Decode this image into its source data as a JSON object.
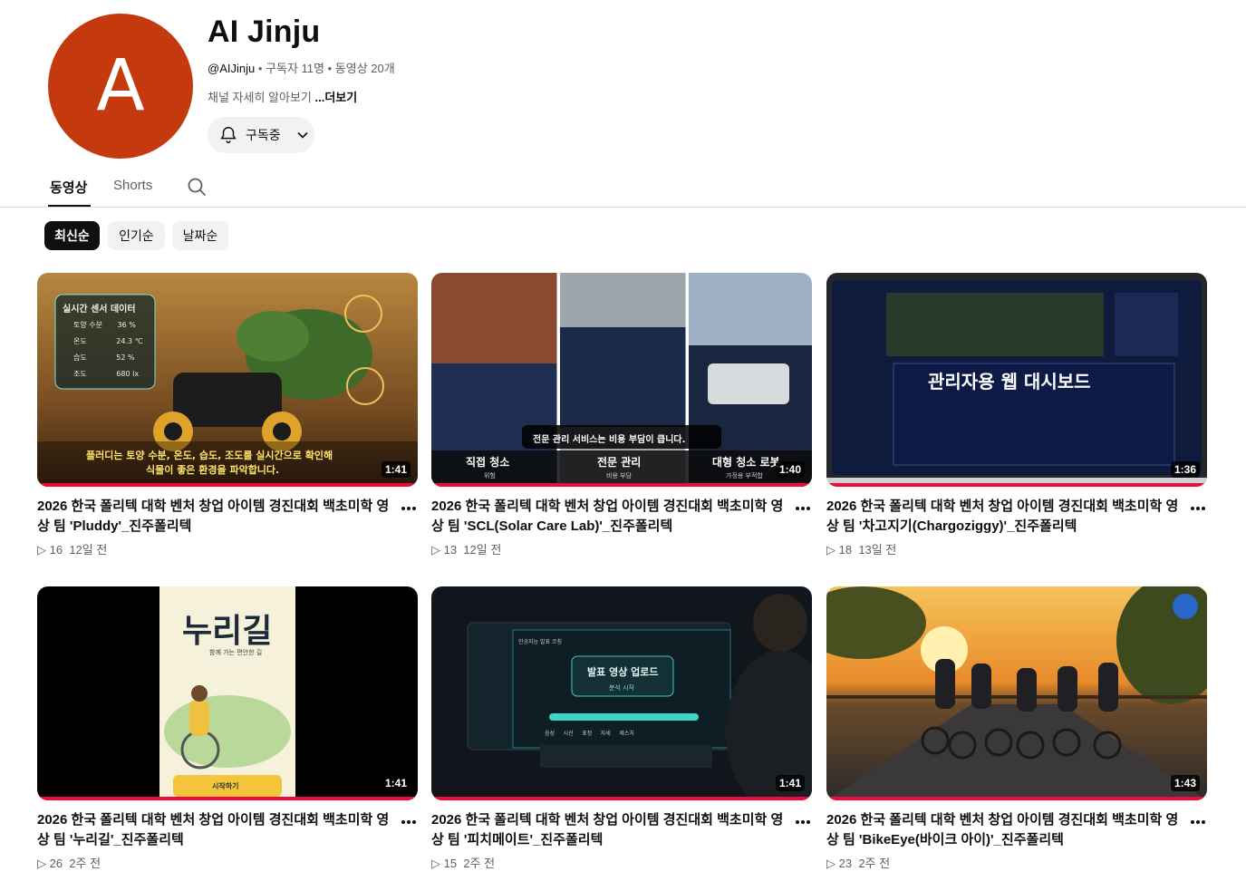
{
  "channel": {
    "avatar_letter": "A",
    "avatar_color": "#c5390f",
    "name": "AI Jinju",
    "handle": "@AIJinju",
    "subscribers": "구독자 11명",
    "video_count": "동영상 20개",
    "separator": "•",
    "description": "채널 자세히 알아보기",
    "more_label": "...더보기",
    "subscribe_label": "구독중",
    "bell_icon": "bell-icon",
    "dropdown_icon": "chevron-down-icon"
  },
  "tabs": [
    {
      "label": "동영상",
      "active": true
    },
    {
      "label": "Shorts",
      "active": false
    }
  ],
  "search_icon": "search-icon",
  "chips": [
    {
      "label": "최신순",
      "active": true
    },
    {
      "label": "인기순",
      "active": false
    },
    {
      "label": "날짜순",
      "active": false
    }
  ],
  "accent_color": "#f00a3a",
  "videos": [
    {
      "title": "2026 한국 폴리텍 대학 벤처 창업 아이템 경진대회 백초미학 영상 팀 'Pluddy'_진주폴리텍",
      "duration": "1:41",
      "views": "16",
      "age": "12일 전",
      "thumb_text": {
        "panel_title": "실시간 센서 데이터",
        "rows": [
          {
            "label": "토양 수분",
            "value": "36 %"
          },
          {
            "label": "온도",
            "value": "24.3 ℃"
          },
          {
            "label": "습도",
            "value": "52 %"
          },
          {
            "label": "조도",
            "value": "680 lx"
          }
        ],
        "caption1": "플러디는 토양 수분, 온도, 습도, 조도를 실시간으로 확인해",
        "caption2": "식물이 좋은 환경을 파악합니다."
      }
    },
    {
      "title": "2026 한국 폴리텍 대학 벤처 창업 아이템 경진대회 백초미학 영상 팀 'SCL(Solar Care Lab)'_진주폴리텍",
      "duration": "1:40",
      "views": "13",
      "age": "12일 전",
      "thumb_text": {
        "banner": "전문 관리 서비스는 비용 부담이 큽니다.",
        "labels": [
          {
            "label": "직접 청소",
            "sub": "위험"
          },
          {
            "label": "전문 관리",
            "sub": "비용 부담"
          },
          {
            "label": "대형 청소 로봇",
            "sub": "가정용 부적합"
          }
        ]
      }
    },
    {
      "title": "2026 한국 폴리텍 대학 벤처 창업 아이템 경진대회 백초미학 영상 팀 '차고지기(Chargoziggy)'_진주폴리텍",
      "duration": "1:36",
      "views": "18",
      "age": "13일 전",
      "thumb_text": {
        "headline": "관리자용 웹 대시보드"
      }
    },
    {
      "title": "2026 한국 폴리텍 대학 벤처 창업 아이템 경진대회 백초미학 영상 팀 '누리길'_진주폴리텍",
      "duration": "1:41",
      "views": "26",
      "age": "2주 전",
      "thumb_text": {
        "logo": "누리길",
        "tagline": "함께 가는 편안한 길",
        "button": "시작하기"
      }
    },
    {
      "title": "2026 한국 폴리텍 대학 벤처 창업 아이템 경진대회 백초미학 영상 팀 '피치메이트'_진주폴리텍",
      "duration": "1:41",
      "views": "15",
      "age": "2주 전",
      "thumb_text": {
        "window_title": "인공지능 발표 코칭",
        "upload": "발표 영상 업로드",
        "upload_sub": "분석 시작",
        "tags": [
          "음성",
          "시선",
          "표정",
          "자세",
          "제스처"
        ]
      }
    },
    {
      "title": "2026 한국 폴리텍 대학 벤처 창업 아이템 경진대회 백초미학 영상 팀 'BikeEye(바이크 아이)'_진주폴리텍",
      "duration": "1:43",
      "views": "23",
      "age": "2주 전",
      "thumb_text": {}
    }
  ]
}
